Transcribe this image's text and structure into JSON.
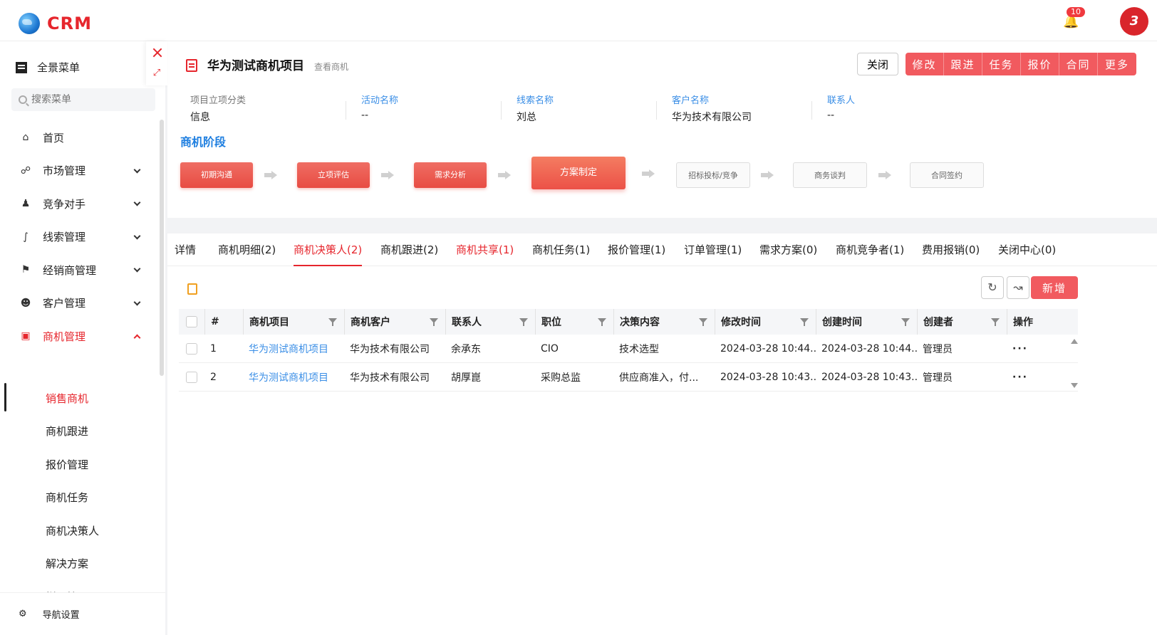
{
  "app": {
    "logo_text": "CRM",
    "notification_count": "10",
    "brand_badge": "3"
  },
  "sidebar": {
    "menu_title": "全景菜单",
    "search_placeholder": "搜索菜单",
    "items": [
      {
        "label": "首页",
        "icon": "home-icon"
      },
      {
        "label": "市场管理",
        "icon": "market-icon"
      },
      {
        "label": "竞争对手",
        "icon": "competitor-icon"
      },
      {
        "label": "线索管理",
        "icon": "lead-icon"
      },
      {
        "label": "经销商管理",
        "icon": "dealer-icon"
      },
      {
        "label": "客户管理",
        "icon": "customer-icon"
      },
      {
        "label": "商机管理",
        "icon": "briefcase-icon"
      }
    ],
    "sub_items": [
      "销售商机",
      "商机跟进",
      "报价管理",
      "商机任务",
      "商机决策人",
      "解决方案",
      "样品管理"
    ],
    "nav_setting": "导航设置"
  },
  "header": {
    "title": "华为测试商机项目",
    "subtitle": "查看商机",
    "close_label": "关闭",
    "actions": [
      "修改",
      "跟进",
      "任务",
      "报价",
      "合同",
      "更多"
    ]
  },
  "info": [
    {
      "label": "项目立项分类",
      "value": "信息"
    },
    {
      "label": "活动名称",
      "value": "--"
    },
    {
      "label": "线索名称",
      "value": "刘总"
    },
    {
      "label": "客户名称",
      "value": "华为技术有限公司"
    },
    {
      "label": "联系人",
      "value": "--"
    }
  ],
  "stage_title": "商机阶段",
  "stages": [
    "初期沟通",
    "立项评估",
    "需求分析",
    "方案制定",
    "招标投标/竞争",
    "商务谈判",
    "合同签约"
  ],
  "tabs": [
    "详情",
    "商机明细(2)",
    "商机决策人(2)",
    "商机跟进(2)",
    "商机共享(1)",
    "商机任务(1)",
    "报价管理(1)",
    "订单管理(1)",
    "需求方案(0)",
    "商机竞争者(1)",
    "费用报销(0)",
    "关闭中心(0)"
  ],
  "toolbar": {
    "add_label": "新增"
  },
  "table": {
    "headers": [
      "#",
      "商机项目",
      "商机客户",
      "联系人",
      "职位",
      "决策内容",
      "修改时间",
      "创建时间",
      "创建者",
      "操作"
    ],
    "rows": [
      [
        "1",
        "华为测试商机项目",
        "华为技术有限公司",
        "余承东",
        "CIO",
        "技术选型",
        "2024-03-28 10:44...",
        "2024-03-28 10:44...",
        "管理员",
        "···"
      ],
      [
        "2",
        "华为测试商机项目",
        "华为技术有限公司",
        "胡厚崑",
        "采购总监",
        "供应商准入，付...",
        "2024-03-28 10:43...",
        "2024-03-28 10:43...",
        "管理员",
        "···"
      ]
    ]
  },
  "colors": {
    "accent": "#e6262d",
    "button": "#f15a5f",
    "link": "#3a8ee6"
  }
}
